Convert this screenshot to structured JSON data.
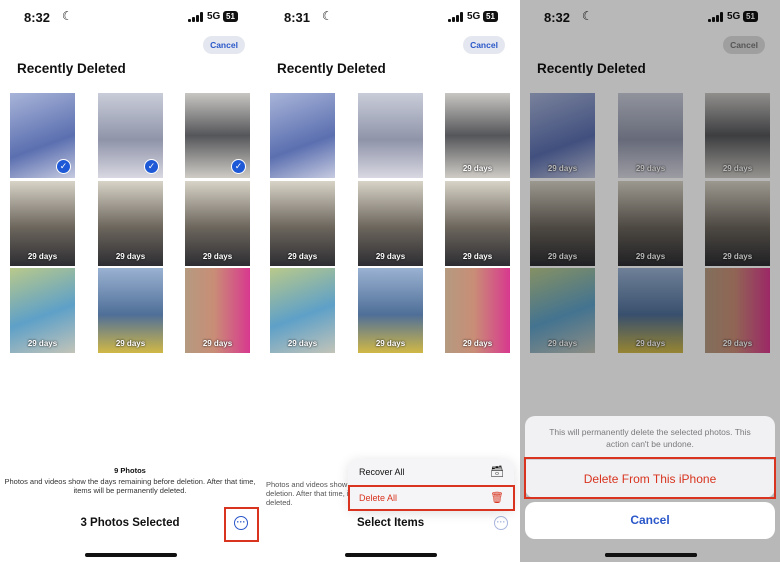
{
  "screens": [
    {
      "status": {
        "time": "8:32",
        "network": "5G",
        "battery": "51"
      },
      "cancel_label": "Cancel",
      "title": "Recently Deleted",
      "tiles": [
        "",
        "",
        "",
        "29 days",
        "29 days",
        "29 days",
        "29 days",
        "29 days",
        "29 days"
      ],
      "selected": [
        true,
        true,
        true,
        false,
        false,
        false,
        false,
        false,
        false
      ],
      "note_count": "9 Photos",
      "note_text": "Photos and videos show the days remaining before deletion. After that time, items will be permanently deleted.",
      "bottom_label": "3 Photos Selected"
    },
    {
      "status": {
        "time": "8:31",
        "network": "5G",
        "battery": "51"
      },
      "cancel_label": "Cancel",
      "title": "Recently Deleted",
      "tiles": [
        "",
        "",
        "29 days",
        "29 days",
        "29 days",
        "29 days",
        "29 days",
        "29 days",
        "29 days"
      ],
      "note_text": "Photos and videos show the days remaining before deletion. After that time, items will be permanently deleted.",
      "menu": {
        "recover_all": "Recover All",
        "delete_all": "Delete All"
      },
      "bottom_label": "Select Items"
    },
    {
      "status": {
        "time": "8:32",
        "network": "5G",
        "battery": "51"
      },
      "cancel_label": "Cancel",
      "title": "Recently Deleted",
      "tiles": [
        "29 days",
        "29 days",
        "29 days",
        "29 days",
        "29 days",
        "29 days",
        "29 days",
        "29 days",
        "29 days"
      ],
      "sheet": {
        "message": "This will permanently delete the selected photos. This action can't be undone.",
        "delete_label": "Delete From This iPhone",
        "cancel_label": "Cancel"
      }
    }
  ],
  "colors": {
    "accent": "#2a57c9",
    "destructive": "#d8341f",
    "highlight_box": "#d8341f"
  },
  "icons": [
    "moon-icon",
    "signal-icon",
    "battery-icon",
    "checkmark-icon",
    "ellipsis-icon",
    "archive-icon",
    "trash-icon"
  ]
}
